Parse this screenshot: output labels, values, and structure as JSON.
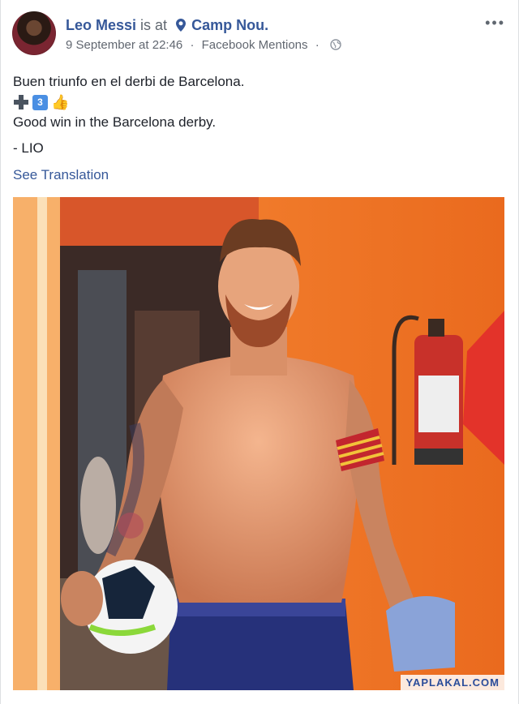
{
  "post": {
    "author": "Leo Messi",
    "is_at": "is at",
    "location": "Camp Nou.",
    "timestamp": "9 September at 22:46",
    "source": "Facebook Mentions",
    "dot_sep": "·",
    "more_label": "•••",
    "line1": "Buen triunfo en el derbi de Barcelona.",
    "emoji_number": "3",
    "line2": "Good win in the Barcelona derby.",
    "signature": "- LIO",
    "see_translation": "See Translation"
  },
  "photo": {
    "watermark": "YAPLAKAL.COM"
  },
  "icons": {
    "pin": "location-pin-icon",
    "globe": "globe-privacy-icon",
    "plus": "heavy-plus-icon",
    "keycap": "keycap-3-icon",
    "hand": "thumbs-up-hand-icon"
  },
  "colors": {
    "link": "#365899",
    "text": "#1d2129",
    "meta": "#616770",
    "photo_bg": "#f07324"
  }
}
